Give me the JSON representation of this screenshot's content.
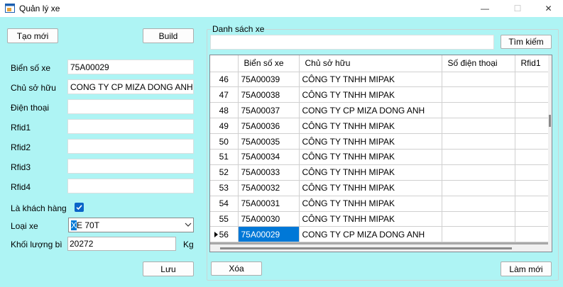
{
  "window": {
    "title": "Quản lý xe",
    "minimize_glyph": "—",
    "maximize_glyph": "☐",
    "close_glyph": "✕"
  },
  "left": {
    "new_button": "Tạo mới",
    "build_button": "Build",
    "fields": {
      "plate_label": "Biển số xe",
      "plate_value": "75A00029",
      "owner_label": "Chủ sở hữu",
      "owner_value": "CONG TY CP MIZA DONG ANH",
      "phone_label": "Điện thoại",
      "phone_value": "",
      "rfid1_label": "Rfid1",
      "rfid1_value": "",
      "rfid2_label": "Rfid2",
      "rfid2_value": "",
      "rfid3_label": "Rfid3",
      "rfid3_value": "",
      "rfid4_label": "Rfid4",
      "rfid4_value": ""
    },
    "is_customer_label": "Là khách hàng",
    "is_customer_checked": true,
    "vehicle_type_label": "Loại xe",
    "vehicle_type_value_hl": "X",
    "vehicle_type_value_rest": "E 70T",
    "weight_label": "Khối lượng bì",
    "weight_value": "20272",
    "weight_unit": "Kg",
    "save_button": "Lưu"
  },
  "right": {
    "group_title": "Danh sách xe",
    "search_value": "",
    "search_button": "Tìm kiếm",
    "delete_button": "Xóa",
    "refresh_button": "Làm mới",
    "columns": [
      "",
      "Biển số xe",
      "Chủ sở hữu",
      "Số điện thoại",
      "Rfid1"
    ],
    "rows": [
      {
        "id": "46",
        "plate": "75A00039",
        "owner": "CÔNG TY TNHH MIPAK",
        "phone": "",
        "rfid1": ""
      },
      {
        "id": "47",
        "plate": "75A00038",
        "owner": "CÔNG TY TNHH MIPAK",
        "phone": "",
        "rfid1": ""
      },
      {
        "id": "48",
        "plate": "75A00037",
        "owner": "CONG TY CP MIZA DONG ANH",
        "phone": "",
        "rfid1": ""
      },
      {
        "id": "49",
        "plate": "75A00036",
        "owner": "CÔNG TY TNHH MIPAK",
        "phone": "",
        "rfid1": ""
      },
      {
        "id": "50",
        "plate": "75A00035",
        "owner": "CÔNG TY TNHH MIPAK",
        "phone": "",
        "rfid1": ""
      },
      {
        "id": "51",
        "plate": "75A00034",
        "owner": "CÔNG TY TNHH MIPAK",
        "phone": "",
        "rfid1": ""
      },
      {
        "id": "52",
        "plate": "75A00033",
        "owner": "CÔNG TY TNHH MIPAK",
        "phone": "",
        "rfid1": ""
      },
      {
        "id": "53",
        "plate": "75A00032",
        "owner": "CÔNG TY TNHH MIPAK",
        "phone": "",
        "rfid1": ""
      },
      {
        "id": "54",
        "plate": "75A00031",
        "owner": "CÔNG TY TNHH MIPAK",
        "phone": "",
        "rfid1": ""
      },
      {
        "id": "55",
        "plate": "75A00030",
        "owner": "CÔNG TY TNHH MIPAK",
        "phone": "",
        "rfid1": ""
      },
      {
        "id": "56",
        "plate": "75A00029",
        "owner": "CONG TY CP MIZA DONG ANH",
        "phone": "",
        "rfid1": "",
        "selected": true
      }
    ]
  },
  "colors": {
    "background": "#aef4f4",
    "selection": "#0078d7",
    "checkbox": "#0a64c8"
  }
}
